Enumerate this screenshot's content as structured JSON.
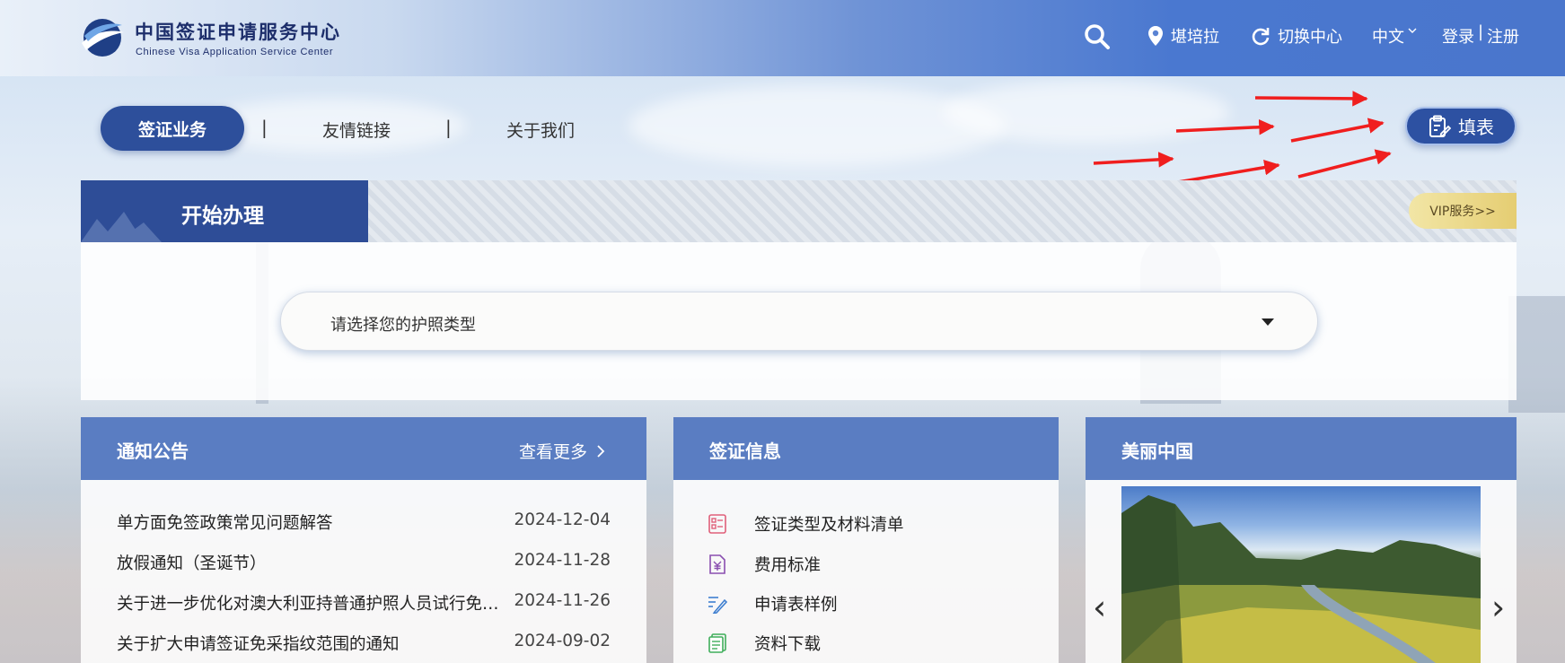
{
  "header": {
    "logo_title": "中国签证申请服务中心",
    "logo_subtitle": "Chinese Visa Application Service Center",
    "location": "堪培拉",
    "switch_center": "切换中心",
    "language": "中文",
    "login": "登录",
    "register": "注册",
    "icons": [
      "search-icon",
      "location-pin-icon",
      "refresh-icon",
      "chevron-down-icon"
    ]
  },
  "nav": {
    "items": [
      {
        "label": "签证业务",
        "active": true
      },
      {
        "label": "友情链接",
        "active": false
      },
      {
        "label": "关于我们",
        "active": false
      }
    ],
    "fill_form": "填表"
  },
  "start": {
    "title": "开始办理",
    "vip": "VIP服务>>",
    "passport_placeholder": "请选择您的护照类型"
  },
  "notices": {
    "title": "通知公告",
    "more": "查看更多",
    "items": [
      {
        "title": "单方面免签政策常见问题解答",
        "date": "2024-12-04"
      },
      {
        "title": "放假通知（圣诞节）",
        "date": "2024-11-28"
      },
      {
        "title": "关于进一步优化对澳大利亚持普通护照人员试行免签政策的通知",
        "date": "2024-11-26"
      },
      {
        "title": "关于扩大申请签证免采指纹范围的通知",
        "date": "2024-09-02"
      }
    ]
  },
  "visa_info": {
    "title": "签证信息",
    "items": [
      {
        "label": "签证类型及材料清单",
        "icon": "checklist-icon",
        "color": "#e0607a"
      },
      {
        "label": "费用标准",
        "icon": "yuan-document-icon",
        "color": "#8a4fb0"
      },
      {
        "label": "申请表样例",
        "icon": "pen-form-icon",
        "color": "#3f7fd0"
      },
      {
        "label": "资料下载",
        "icon": "download-document-icon",
        "color": "#3fae5a"
      }
    ]
  },
  "beautiful_china": {
    "title": "美丽中国",
    "prev": "‹",
    "next": "›"
  },
  "colors": {
    "primary": "#2d4f9b",
    "card_header": "#5a7dc2",
    "annotation_arrow": "#f01e1e"
  }
}
